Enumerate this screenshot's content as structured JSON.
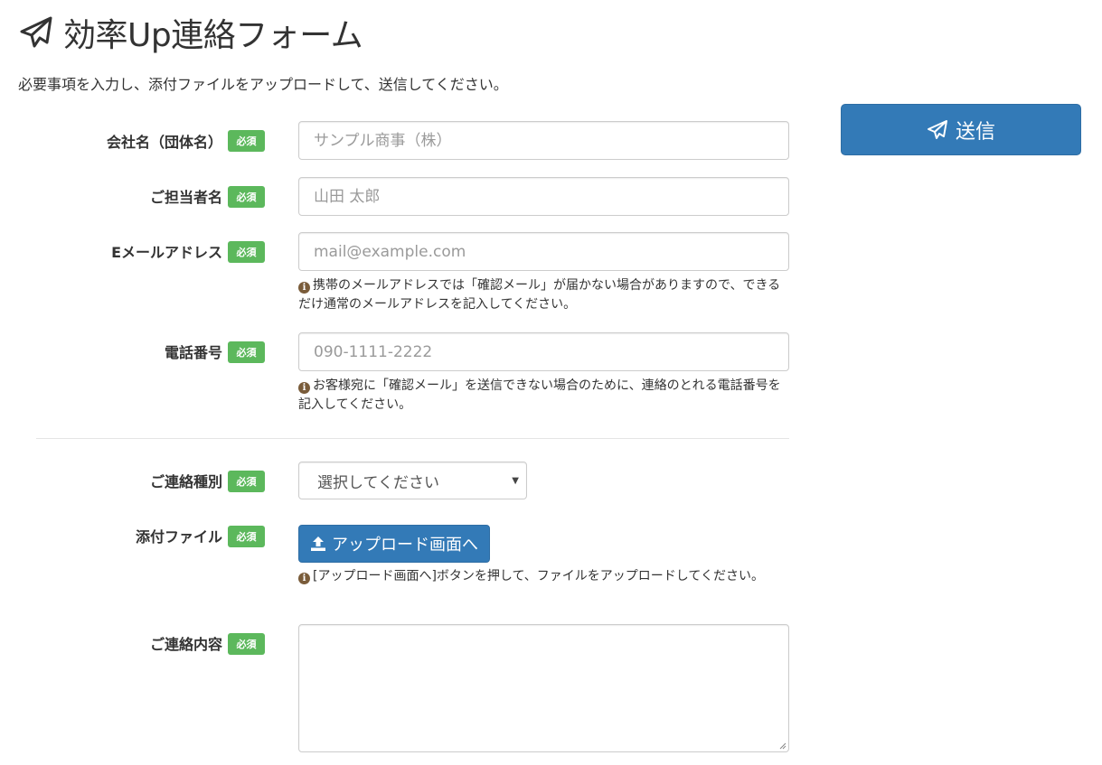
{
  "page": {
    "title": "効率Up連絡フォーム",
    "lead": "必要事項を入力し、添付ファイルをアップロードして、送信してください。"
  },
  "required_badge": "必須",
  "fields": {
    "company": {
      "label": "会社名（団体名）",
      "placeholder": "サンプル商事（株）"
    },
    "person": {
      "label": "ご担当者名",
      "placeholder": "山田 太郎"
    },
    "email": {
      "label": "Eメールアドレス",
      "placeholder": "mail@example.com",
      "help": "携帯のメールアドレスでは「確認メール」が届かない場合がありますので、できるだけ通常のメールアドレスを記入してください。"
    },
    "phone": {
      "label": "電話番号",
      "placeholder": "090-1111-2222",
      "help": "お客様宛に「確認メール」を送信できない場合のために、連絡のとれる電話番号を記入してください。"
    },
    "contact_type": {
      "label": "ご連絡種別",
      "selected": "選択してください"
    },
    "attachment": {
      "label": "添付ファイル",
      "button": "アップロード画面へ",
      "help": "[アップロード画面へ]ボタンを押して、ファイルをアップロードしてください。"
    },
    "message": {
      "label": "ご連絡内容",
      "value": ""
    }
  },
  "submit": {
    "label": "送信"
  },
  "colors": {
    "primary": "#337ab7",
    "badge": "#5cb85c",
    "info_icon": "#7a5c3a"
  },
  "icons": {
    "title": "paper-plane-icon",
    "upload": "upload-icon",
    "info": "info-circle-icon",
    "submit": "paper-plane-icon"
  }
}
